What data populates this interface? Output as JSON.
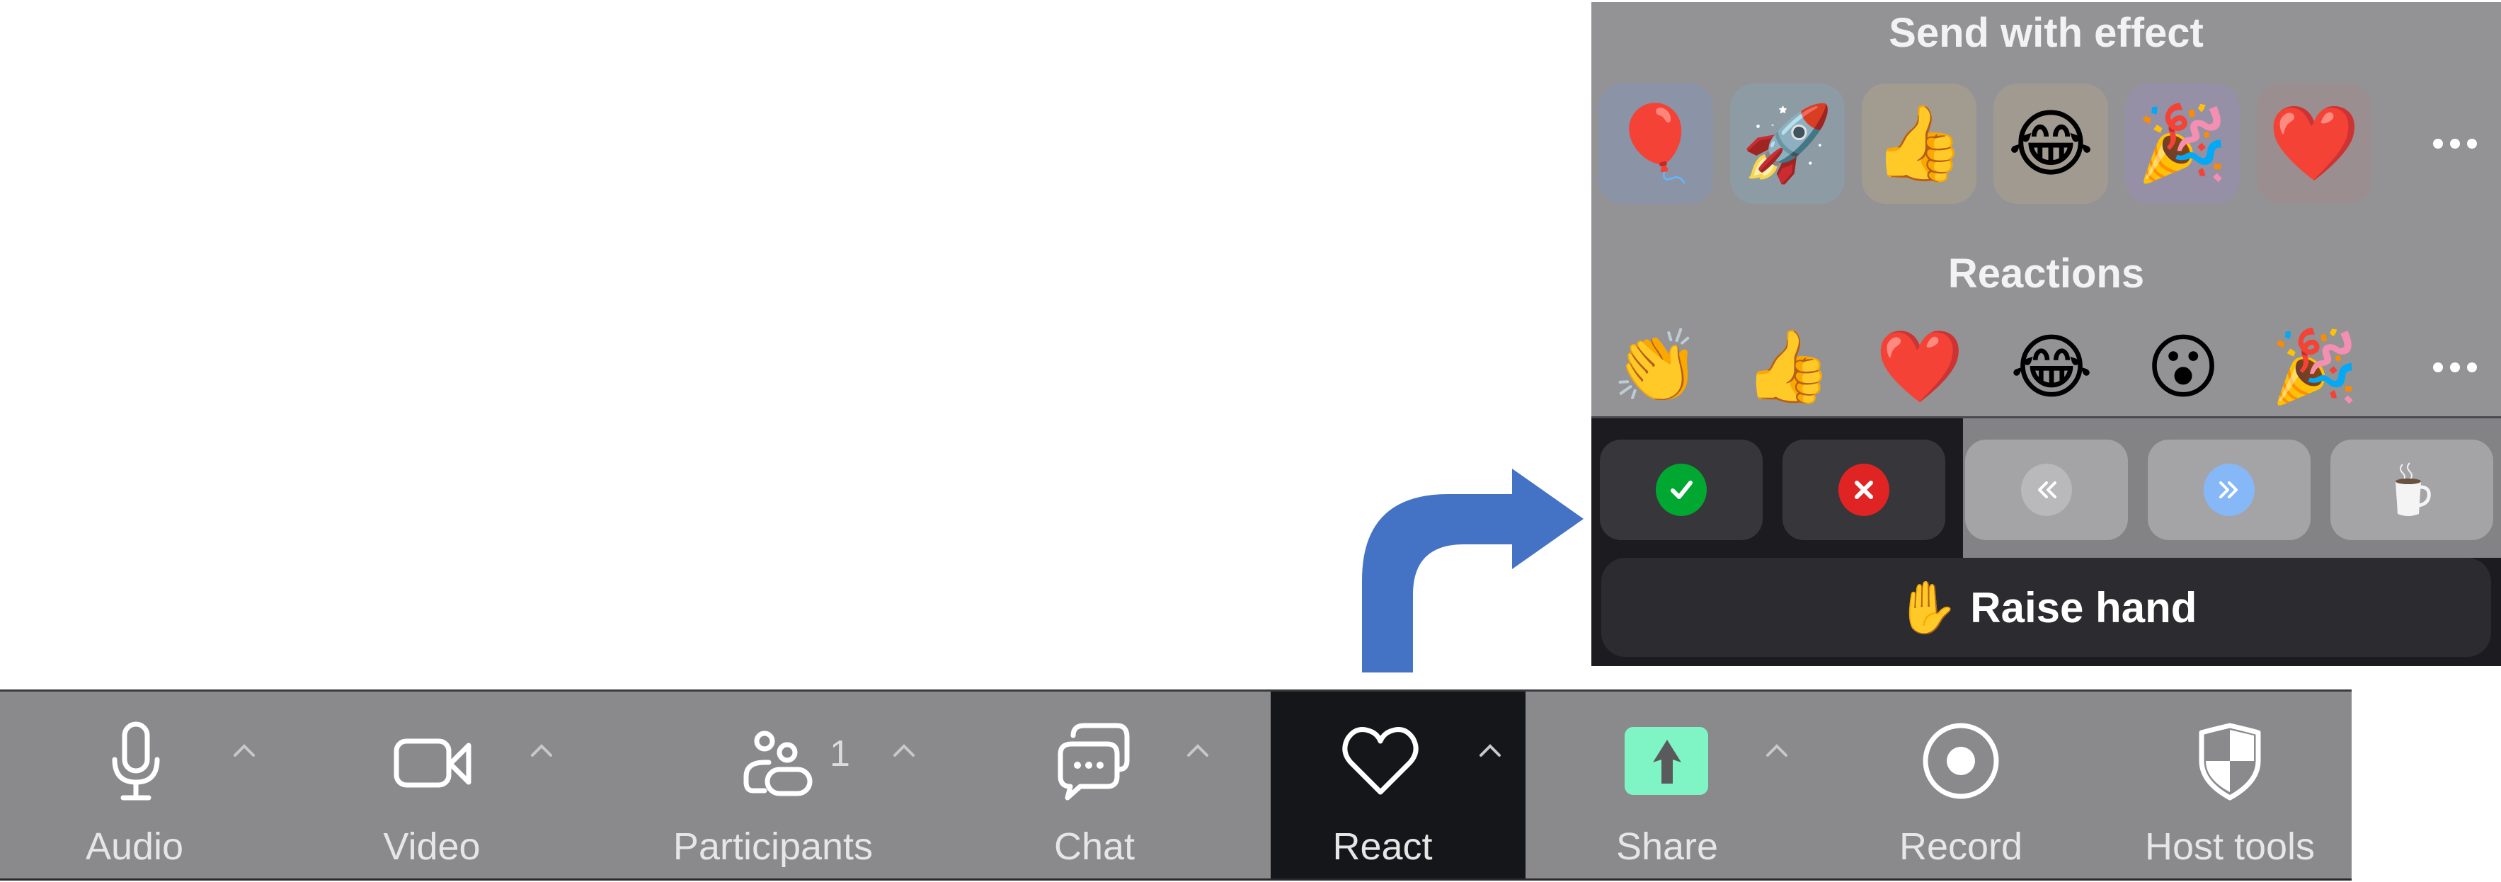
{
  "toolbar": {
    "items": [
      {
        "label": "Audio",
        "icon": "microphone-icon",
        "has_caret": true
      },
      {
        "label": "Video",
        "icon": "video-camera-icon",
        "has_caret": true
      },
      {
        "label": "Participants",
        "icon": "participants-icon",
        "count": "1",
        "has_caret": true
      },
      {
        "label": "Chat",
        "icon": "chat-bubble-icon",
        "has_caret": true
      },
      {
        "label": "React",
        "icon": "heart-icon",
        "has_caret": true,
        "active": true
      },
      {
        "label": "Share",
        "icon": "share-screen-icon",
        "has_caret": true,
        "accent": "#7ff5c6"
      },
      {
        "label": "Record",
        "icon": "record-icon",
        "has_caret": false
      },
      {
        "label": "Host tools",
        "icon": "shield-icon",
        "has_caret": false
      }
    ]
  },
  "reactions_popup": {
    "send_with_effect": {
      "title": "Send with effect",
      "items": [
        {
          "emoji": "🎈",
          "name": "balloon",
          "tint": "#8b93a6"
        },
        {
          "emoji": "🚀",
          "name": "rocket",
          "tint": "#8d9ba4"
        },
        {
          "emoji": "👍",
          "name": "thumbs-up",
          "tint": "#a29b90"
        },
        {
          "emoji": "😂",
          "name": "tears-of-joy",
          "tint": "#a09a91"
        },
        {
          "emoji": "🎉",
          "name": "party-popper",
          "tint": "#9590a6"
        },
        {
          "emoji": "❤️",
          "name": "heart",
          "tint": "#9b8e90"
        }
      ],
      "more": "more-icon"
    },
    "reactions": {
      "title": "Reactions",
      "items": [
        {
          "emoji": "👏",
          "name": "clapping-hands"
        },
        {
          "emoji": "👍",
          "name": "thumbs-up"
        },
        {
          "emoji": "❤️",
          "name": "heart"
        },
        {
          "emoji": "😂",
          "name": "tears-of-joy"
        },
        {
          "emoji": "😮",
          "name": "open-mouth"
        },
        {
          "emoji": "🎉",
          "name": "party-popper"
        }
      ],
      "more": "more-icon"
    },
    "feedback": [
      {
        "name": "yes",
        "icon": "check-icon",
        "color": "#00a832",
        "glyph": "✓"
      },
      {
        "name": "no",
        "icon": "x-icon",
        "color": "#e02424",
        "glyph": "✕"
      },
      {
        "name": "slower",
        "icon": "rewind-icon",
        "color": "#b9b9bb",
        "glyph": "«"
      },
      {
        "name": "faster",
        "icon": "fast-forward-icon",
        "color": "#86b8f7",
        "glyph": "»"
      },
      {
        "name": "coffee",
        "icon": "coffee-icon",
        "glyph": "☕"
      }
    ],
    "raise_hand": {
      "emoji": "✋",
      "label": "Raise hand"
    }
  },
  "annotation": {
    "arrow_color": "#4472C4"
  }
}
